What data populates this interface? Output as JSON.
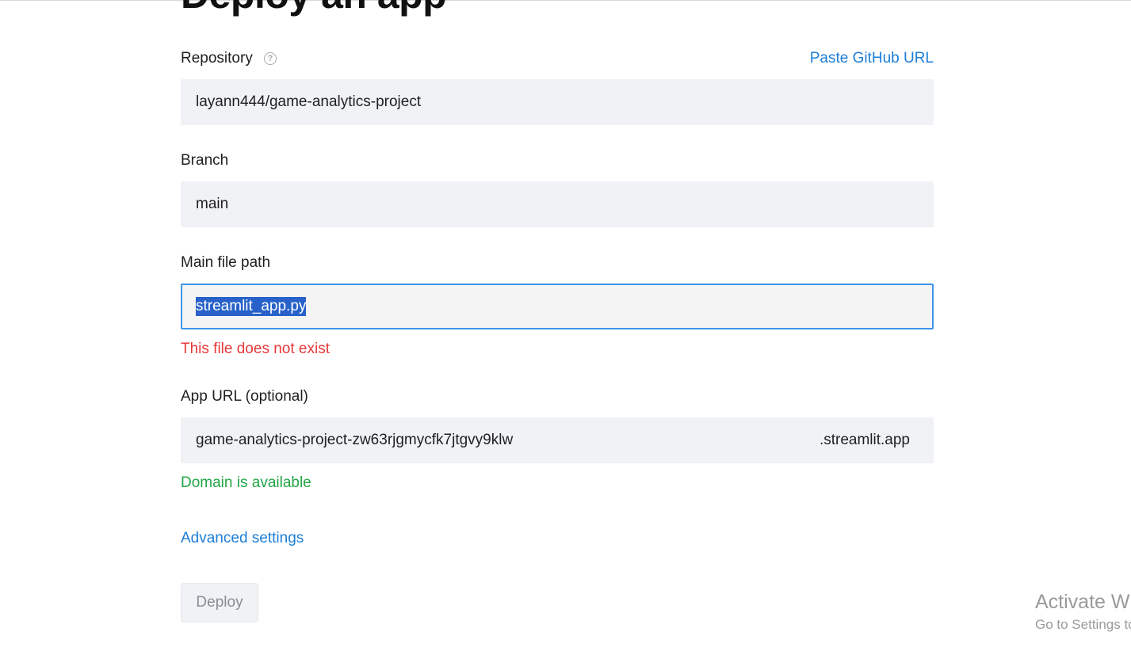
{
  "page": {
    "title": "Deploy an app"
  },
  "repository": {
    "label": "Repository",
    "help_icon": "question-circle-icon",
    "paste_link": "Paste GitHub URL",
    "value": "layann444/game-analytics-project"
  },
  "branch": {
    "label": "Branch",
    "value": "main"
  },
  "main_file": {
    "label": "Main file path",
    "value": "streamlit_app.py",
    "error": "This file does not exist"
  },
  "app_url": {
    "label": "App URL (optional)",
    "value": "game-analytics-project-zw63rjgmycfk7jtgvy9klw",
    "suffix": ".streamlit.app",
    "status": "Domain is available"
  },
  "advanced": {
    "label": "Advanced settings"
  },
  "deploy": {
    "label": "Deploy"
  },
  "watermark": {
    "title": "Activate Windows",
    "subtitle": "Go to Settings to activate Windows."
  },
  "colors": {
    "link": "#1c7ed6",
    "error": "#e8393a",
    "success": "#22a545",
    "field_bg": "#f0f2f6",
    "focus_border": "#3d95e8",
    "selection": "#2761c9"
  }
}
